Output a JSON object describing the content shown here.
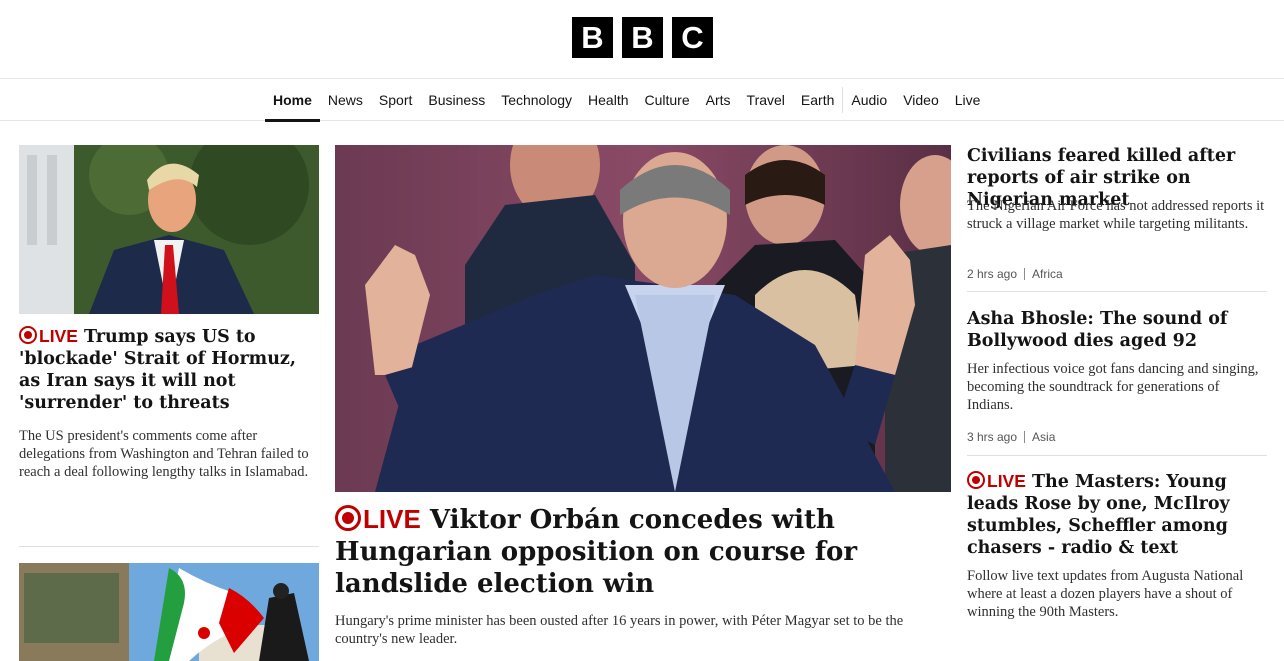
{
  "brand": {
    "letters": [
      "B",
      "B",
      "C"
    ]
  },
  "nav": {
    "items": [
      "Home",
      "News",
      "Sport",
      "Business",
      "Technology",
      "Health",
      "Culture",
      "Arts",
      "Travel",
      "Earth"
    ],
    "items2": [
      "Audio",
      "Video",
      "Live"
    ],
    "active": "Home"
  },
  "left": {
    "story1": {
      "live": "LIVE",
      "headline": "Trump says US to 'blockade' Strait of Hormuz, as Iran says it will not 'surrender' to threats",
      "summary": "The US president's comments come after delegations from Washington and Tehran failed to reach a deal following lengthy talks in Islamabad."
    }
  },
  "main": {
    "live": "LIVE",
    "headline": "Viktor Orbán concedes with Hungarian opposition on course for landslide election win",
    "summary": "Hungary's prime minister has been ousted after 16 years in power, with Péter Magyar set to be the country's new leader."
  },
  "right": {
    "stories": [
      {
        "headline": "Civilians feared killed after reports of air strike on Nigerian market",
        "summary": "The Nigerian Air Force has not addressed reports it struck a village market while targeting militants.",
        "time": "2 hrs ago",
        "section": "Africa"
      },
      {
        "headline": "Asha Bhosle: The sound of Bollywood dies aged 92",
        "summary": "Her infectious voice got fans dancing and singing, becoming the soundtrack for generations of Indians.",
        "time": "3 hrs ago",
        "section": "Asia"
      },
      {
        "live": "LIVE",
        "headline": "The Masters: Young leads Rose by one, McIlroy stumbles, Scheffler among chasers - radio & text",
        "summary": "Follow live text updates from Augusta National where at least a dozen players have a shout of winning the 90th Masters."
      }
    ]
  },
  "colors": {
    "live": "#c00000",
    "text": "#141414",
    "summary": "#303030"
  }
}
